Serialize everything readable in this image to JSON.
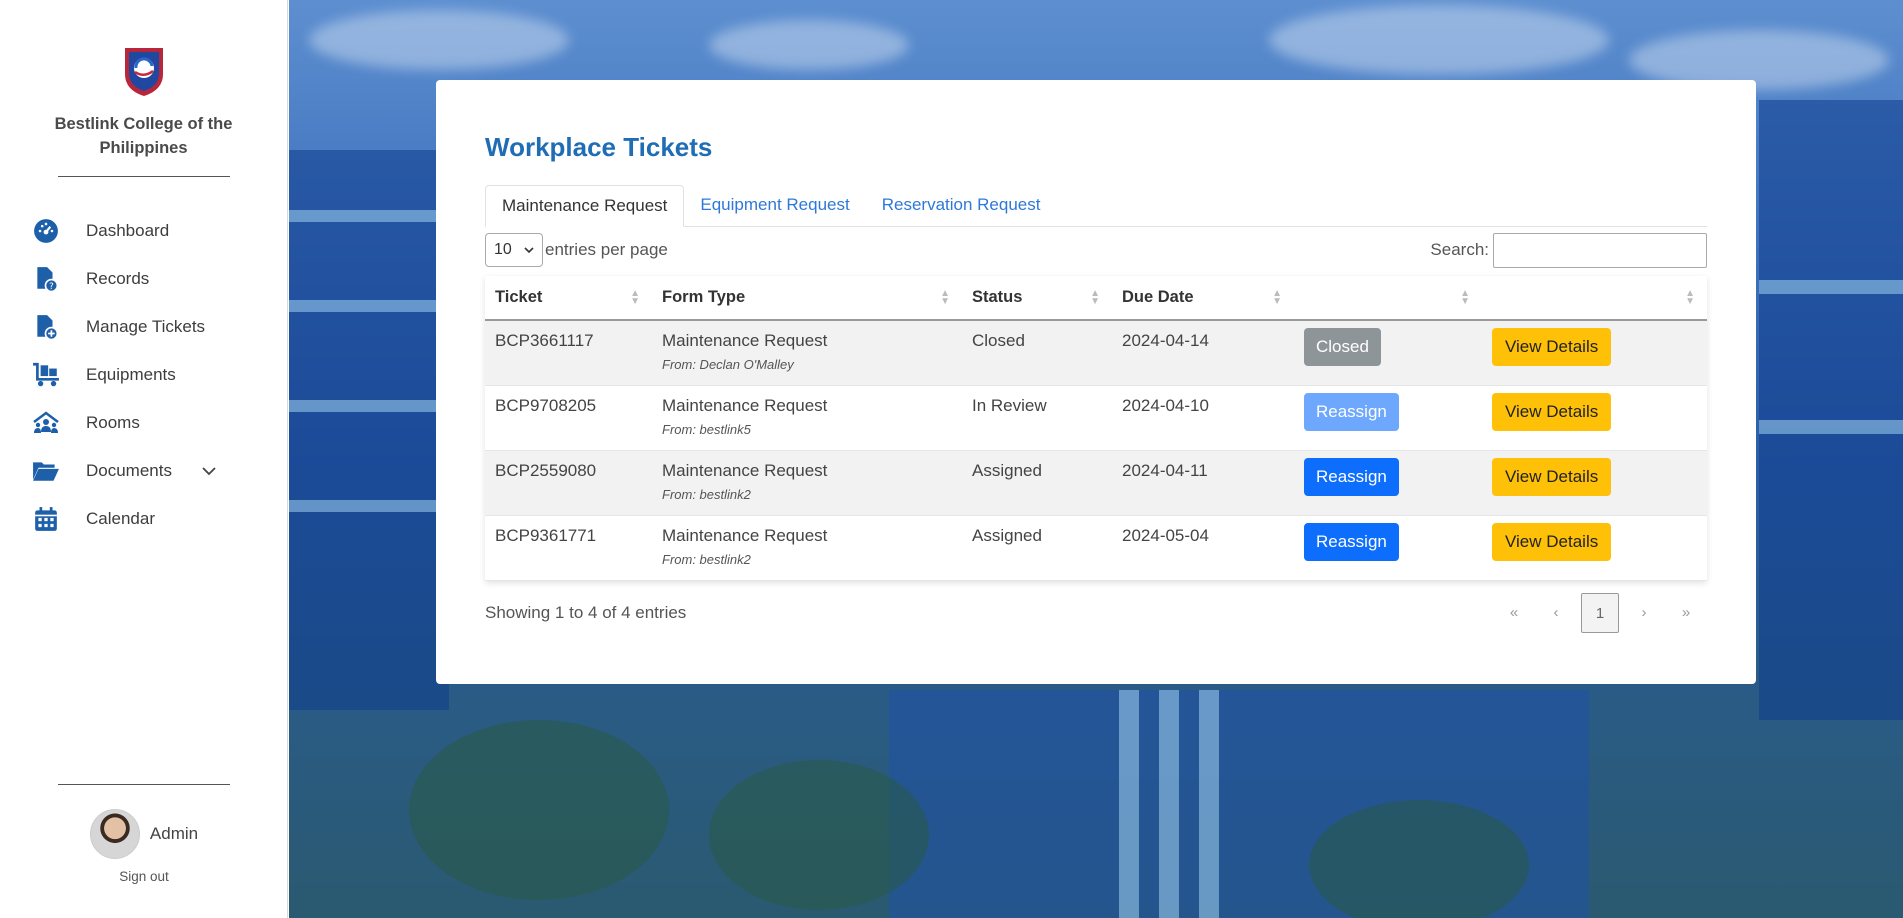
{
  "sidebar": {
    "brand": "Bestlink College of the Philippines",
    "items": [
      {
        "label": "Dashboard",
        "icon": "dashboard-icon"
      },
      {
        "label": "Records",
        "icon": "records-icon"
      },
      {
        "label": "Manage Tickets",
        "icon": "manage-tickets-icon"
      },
      {
        "label": "Equipments",
        "icon": "equipments-icon"
      },
      {
        "label": "Rooms",
        "icon": "rooms-icon"
      },
      {
        "label": "Documents",
        "icon": "folder-icon"
      },
      {
        "label": "Calendar",
        "icon": "calendar-icon"
      }
    ],
    "user": {
      "name": "Admin",
      "signout": "Sign out"
    }
  },
  "main": {
    "title": "Workplace Tickets",
    "tabs": [
      "Maintenance Request",
      "Equipment Request",
      "Reservation Request"
    ],
    "entries_select": "10",
    "entries_label": "entries per page",
    "search_label": "Search:",
    "search_value": "",
    "columns": [
      "Ticket",
      "Form Type",
      "Status",
      "Due Date",
      "",
      ""
    ],
    "rows": [
      {
        "ticket": "BCP3661117",
        "form_type": "Maintenance Request",
        "from": "From: Declan O'Malley",
        "status": "Closed",
        "due": "2024-04-14",
        "action": "Closed",
        "view": "View Details"
      },
      {
        "ticket": "BCP9708205",
        "form_type": "Maintenance Request",
        "from": "From: bestlink5",
        "status": "In Review",
        "due": "2024-04-10",
        "action": "Reassign",
        "view": "View Details"
      },
      {
        "ticket": "BCP2559080",
        "form_type": "Maintenance Request",
        "from": "From: bestlink2",
        "status": "Assigned",
        "due": "2024-04-11",
        "action": "Reassign",
        "view": "View Details"
      },
      {
        "ticket": "BCP9361771",
        "form_type": "Maintenance Request",
        "from": "From: bestlink2",
        "status": "Assigned",
        "due": "2024-05-04",
        "action": "Reassign",
        "view": "View Details"
      }
    ],
    "info": "Showing 1 to 4 of 4 entries",
    "pager": {
      "first": "«",
      "prev": "‹",
      "current": "1",
      "next": "›",
      "last": "»"
    }
  },
  "colors": {
    "accent": "#1f6db5",
    "reassign": "#0d6efd",
    "view": "#ffc107",
    "closed": "#8e9599"
  }
}
